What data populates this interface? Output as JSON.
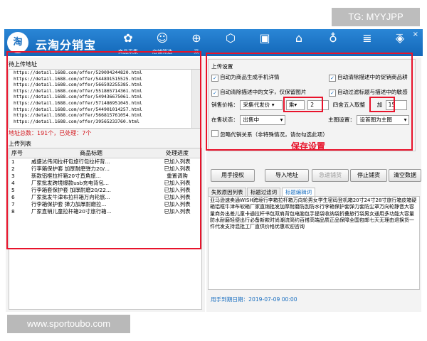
{
  "watermarks": {
    "top": "TG: MYYJPP",
    "bottom": "www.sportoubo.com"
  },
  "app": {
    "logo": "淘",
    "title": "云淘分销宝",
    "toolbar": [
      {
        "icon": "butterfly-icon",
        "glyph": "✿",
        "label": "商品采集"
      },
      {
        "icon": "emoji-icon",
        "glyph": "☺",
        "label": "店铺筛选"
      },
      {
        "icon": "cart-plus-icon",
        "glyph": "⊕",
        "label": "采"
      },
      {
        "icon": "cube-icon",
        "glyph": "⬡",
        "label": ""
      },
      {
        "icon": "box-icon",
        "glyph": "▣",
        "label": ""
      },
      {
        "icon": "home-icon",
        "glyph": "⌂",
        "label": ""
      },
      {
        "icon": "bulb-icon",
        "glyph": "♁",
        "label": ""
      },
      {
        "icon": "document-icon",
        "glyph": "≣",
        "label": ""
      },
      {
        "icon": "package-icon",
        "glyph": "◈",
        "label": ""
      }
    ],
    "window_controls": {
      "minimize": "—",
      "close": "×"
    }
  },
  "left": {
    "upload_label": "待上传地址",
    "urls": [
      "https://detail.1688.com/offer/529094244820.html",
      "https://detail.1688.com/offer/544891515525.html",
      "https://detail.1688.com/offer/566592255385.html",
      "https://detail.1688.com/offer/551865714361.html",
      "https://detail.1688.com/offer/549436675061.html",
      "https://detail.1688.com/offer/571486951045.html",
      "https://detail.1688.com/offer/544901014257.html",
      "https://detail.1688.com/offer/566815761054.html",
      "https://detail.1688.com/offer/39565233760.html"
    ],
    "count_text": "地址总数：191个，已处理：7个",
    "upload_list_label": "上传列表",
    "columns": [
      "序号",
      "商品标题",
      "处理进度"
    ],
    "rows": [
      {
        "no": "1",
        "title": "威盛达伟闲拉杆包旅行包拉杆背...",
        "status": "已加入列表"
      },
      {
        "no": "2",
        "title": "行李箱保护套 加厚耐磨弹力20/...",
        "status": "已加入列表"
      },
      {
        "no": "3",
        "title": "新款铝框拉杆箱20寸直角旅...",
        "status": "重置调购"
      },
      {
        "no": "4",
        "title": "厂家批发跨境爆款usb充电背包...",
        "status": "已加入列表"
      },
      {
        "no": "5",
        "title": "行李箱套保护套 加厚耐磨20/22...",
        "status": "已加入列表"
      },
      {
        "no": "6",
        "title": "厂家批发牛津布拉杆箱万向轮旅...",
        "status": "已加入列表"
      },
      {
        "no": "7",
        "title": "行李箱保护套 弹力加厚耐磨拉...",
        "status": "已加入列表"
      },
      {
        "no": "8",
        "title": "厂家直销儿童拉杆箱20寸旅行箱...",
        "status": "已加入列表"
      }
    ]
  },
  "settings": {
    "title": "上传设置",
    "checks": [
      {
        "label": "自动为商品生成手机详情",
        "checked": true
      },
      {
        "label": "自动清除描述中的促销商品耕",
        "checked": true
      },
      {
        "label": "自动清除描述中的文字，仅保留图片",
        "checked": true
      },
      {
        "label": "自动过滤标题与描述中的敏感",
        "checked": true
      }
    ],
    "price_label": "销售价格：",
    "price_source": "采集代发价",
    "operator": "乘",
    "multiplier": "2",
    "round_label": "四舍五入取整",
    "add_label": "加",
    "add_value": "15",
    "status_label": "在售状态：",
    "status_value": "出售中",
    "main_image_label": "主图设置：",
    "main_image_value": "设首图为主图",
    "ignore_label": "忽略代销关系（非特殊情况，请勿勾选此项）",
    "ignore_checked": false,
    "save_label": "保存设置"
  },
  "buttons": {
    "authorize": "用手授权",
    "import": "导入地址",
    "start": "急速铺货",
    "stop": "停止铺货",
    "clear": "清空数据"
  },
  "tabs": [
    "失败原因列表",
    "标题过滤词",
    "标题编辑词"
  ],
  "active_tab": 2,
  "editor_text": "亚马逊速卖通WISH跨境行李箱拉杆箱万向轮男女学生密码登机箱20寸24寸28寸旅行箱皮箱硬箱铝框牛津布软箱厂家直销批发加厚耐磨防刮防水行李箱保护套弹力套防尘罩万向轮静音大容量商务出差儿童卡通拉杆书包双肩背包电脑包手提袋收纳袋折叠旅行袋男女通用多功能大容量防水耐磨轻便出行必备新款时尚潮流简约百搭高端品质正品保障全国包邮七天无理由退换货一件代发支持混批工厂直供价格优惠欢迎咨询",
  "expiry": "用手到期日期：2019-07-09 00:00"
}
